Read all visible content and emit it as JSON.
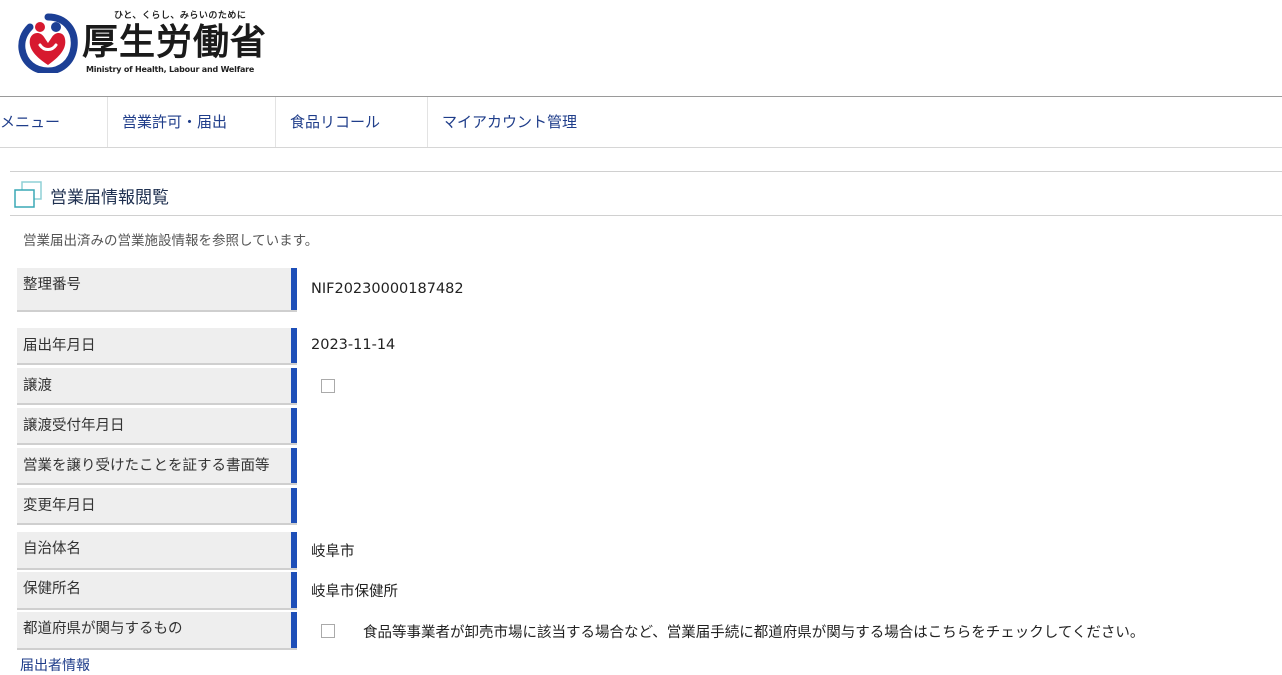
{
  "header": {
    "tagline": "ひと、くらし、みらいのために",
    "org_name": "厚生労働省",
    "org_name_en": "Ministry of Health, Labour and Welfare"
  },
  "nav": {
    "items": [
      "メニュー",
      "営業許可・届出",
      "食品リコール",
      "マイアカウント管理"
    ]
  },
  "section": {
    "title": "営業届情報閲覧",
    "description": "営業届出済みの営業施設情報を参照しています。"
  },
  "fields": {
    "seiri_bango": {
      "label": "整理番号",
      "value": "NIF20230000187482"
    },
    "todokede_date": {
      "label": "届出年月日",
      "value": "2023-11-14"
    },
    "joto": {
      "label": "譲渡",
      "checked": false
    },
    "joto_date": {
      "label": "譲渡受付年月日",
      "value": ""
    },
    "joto_doc": {
      "label": "営業を譲り受けたことを証する書面等",
      "value": ""
    },
    "henko_date": {
      "label": "変更年月日",
      "value": ""
    },
    "jichitai": {
      "label": "自治体名",
      "value": "岐阜市"
    },
    "hokenjo": {
      "label": "保健所名",
      "value": "岐阜市保健所"
    },
    "todofuken": {
      "label": "都道府県が関与するもの",
      "checked": false,
      "note": "食品等事業者が卸売市場に該当する場合など、営業届手続に都道府県が関与する場合はこちらをチェックしてください。"
    }
  },
  "partial_heading": "届出者情報",
  "colors": {
    "accent_bar": "#1e4fb8",
    "nav_link": "#1f3d8a",
    "logo_red": "#d7192f",
    "logo_blue": "#1c3f95"
  },
  "icons": {
    "logo": "mhlw-logo-icon",
    "section": "window-squares-icon"
  }
}
